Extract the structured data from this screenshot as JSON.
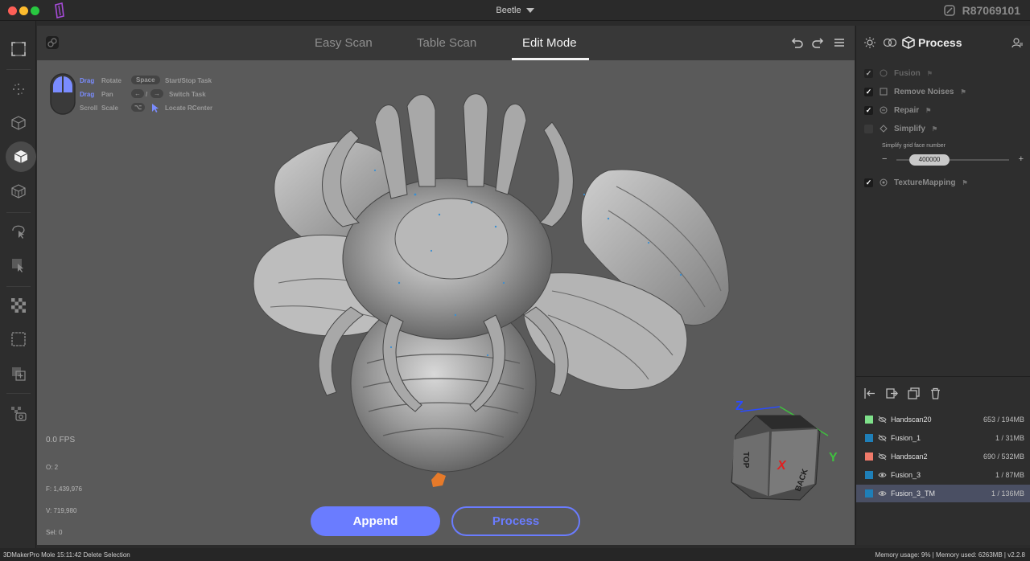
{
  "window": {
    "title": "Beetle",
    "device_id": "R87069101"
  },
  "tabs": [
    {
      "label": "Easy Scan",
      "active": false
    },
    {
      "label": "Table Scan",
      "active": false
    },
    {
      "label": "Edit Mode",
      "active": true
    }
  ],
  "hints": {
    "drag_rotate_key": "Drag",
    "drag_rotate_action": "Rotate",
    "drag_pan_key": "Drag",
    "drag_pan_action": "Pan",
    "scroll_key": "Scroll",
    "scroll_action": "Scale",
    "space_key": "Space",
    "space_action": "Start/Stop Task",
    "switch_separator": "/",
    "switch_action": "Switch Task",
    "locate_action": "Locate RCenter"
  },
  "viewport_stats": {
    "fps": "0.0 FPS",
    "o": "O: 2",
    "f": "F: 1,439,976",
    "v": "V: 719,980",
    "sel": "Sel: 0"
  },
  "axes": {
    "z": "Z",
    "y": "Y",
    "x": "X",
    "face_top": "TOP",
    "face_back": "BACK"
  },
  "buttons": {
    "append": "Append",
    "process": "Process"
  },
  "process_panel": {
    "title": "Process",
    "items": [
      {
        "label": "Fusion",
        "checked": true,
        "disabled": true
      },
      {
        "label": "Remove Noises",
        "checked": true
      },
      {
        "label": "Repair",
        "checked": true
      },
      {
        "label": "Simplify",
        "checked": false
      },
      {
        "label": "TextureMapping",
        "checked": true
      }
    ],
    "simplify_label": "Simplify grid face number",
    "simplify_value": "400000",
    "minus": "−",
    "plus": "+"
  },
  "layers": [
    {
      "name": "Handscan20",
      "size": "653 / 194MB",
      "color": "#7ee08a",
      "selected": false
    },
    {
      "name": "Fusion_1",
      "size": "1 / 31MB",
      "color": "#1f7fb8",
      "selected": false
    },
    {
      "name": "Handscan2",
      "size": "690 / 532MB",
      "color": "#f07a6a",
      "selected": false
    },
    {
      "name": "Fusion_3",
      "size": "1 / 87MB",
      "color": "#1f7fb8",
      "selected": false
    },
    {
      "name": "Fusion_3_TM",
      "size": "1 / 136MB",
      "color": "#1f7fb8",
      "selected": true
    }
  ],
  "statusbar": {
    "left": "3DMakerPro Mole   15:11:42 Delete Selection",
    "right": "Memory usage: 9% | Memory used: 6263MB | v2.2.8"
  },
  "colors": {
    "accent": "#6a7cff"
  }
}
